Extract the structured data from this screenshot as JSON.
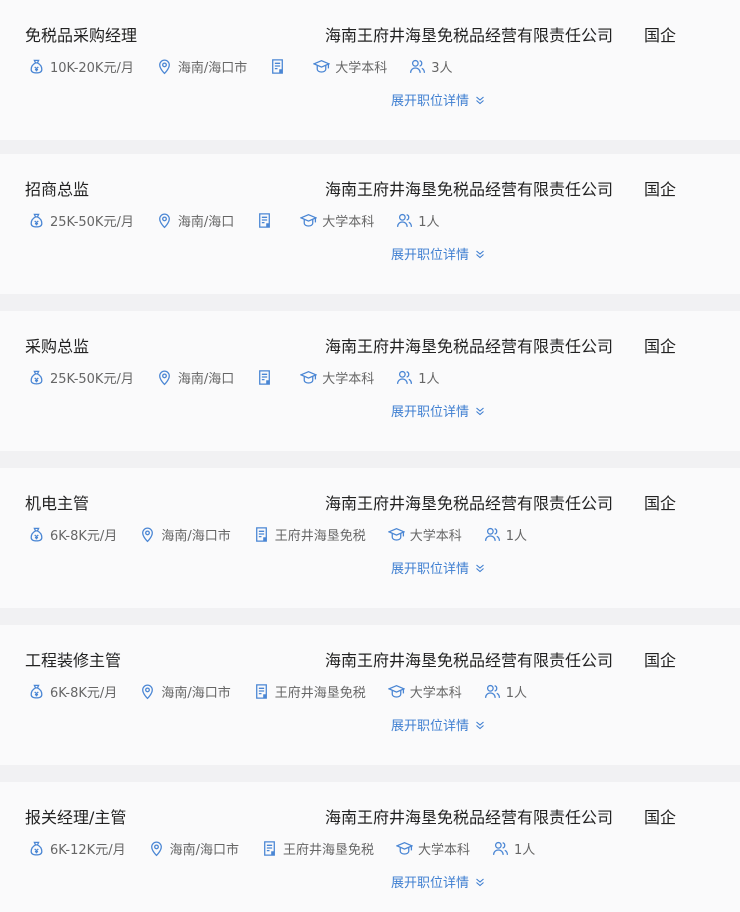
{
  "colors": {
    "icon": "#4a86d4",
    "link": "#3f7fd1",
    "card_bg": "#fafafb",
    "page_bg": "#f1f1f3"
  },
  "icons": {
    "salary": "money-bag-icon",
    "location": "location-pin-icon",
    "department": "document-icon",
    "education": "graduation-cap-icon",
    "headcount": "people-icon",
    "expand": "chevron-down-icon"
  },
  "jobs": [
    {
      "title": "免税品采购经理",
      "company": "海南王府井海垦免税品经营有限责任公司",
      "company_type": "国企",
      "salary": "10K-20K元/月",
      "location": "海南/海口市",
      "department": "",
      "education": "大学本科",
      "headcount": "3人",
      "expand_label": "展开职位详情"
    },
    {
      "title": "招商总监",
      "company": "海南王府井海垦免税品经营有限责任公司",
      "company_type": "国企",
      "salary": "25K-50K元/月",
      "location": "海南/海口",
      "department": "",
      "education": "大学本科",
      "headcount": "1人",
      "expand_label": "展开职位详情"
    },
    {
      "title": "采购总监",
      "company": "海南王府井海垦免税品经营有限责任公司",
      "company_type": "国企",
      "salary": "25K-50K元/月",
      "location": "海南/海口",
      "department": "",
      "education": "大学本科",
      "headcount": "1人",
      "expand_label": "展开职位详情"
    },
    {
      "title": "机电主管",
      "company": "海南王府井海垦免税品经营有限责任公司",
      "company_type": "国企",
      "salary": "6K-8K元/月",
      "location": "海南/海口市",
      "department": "王府井海垦免税",
      "education": "大学本科",
      "headcount": "1人",
      "expand_label": "展开职位详情"
    },
    {
      "title": "工程装修主管",
      "company": "海南王府井海垦免税品经营有限责任公司",
      "company_type": "国企",
      "salary": "6K-8K元/月",
      "location": "海南/海口市",
      "department": "王府井海垦免税",
      "education": "大学本科",
      "headcount": "1人",
      "expand_label": "展开职位详情"
    },
    {
      "title": "报关经理/主管",
      "company": "海南王府井海垦免税品经营有限责任公司",
      "company_type": "国企",
      "salary": "6K-12K元/月",
      "location": "海南/海口市",
      "department": "王府井海垦免税",
      "education": "大学本科",
      "headcount": "1人",
      "expand_label": "展开职位详情"
    }
  ]
}
